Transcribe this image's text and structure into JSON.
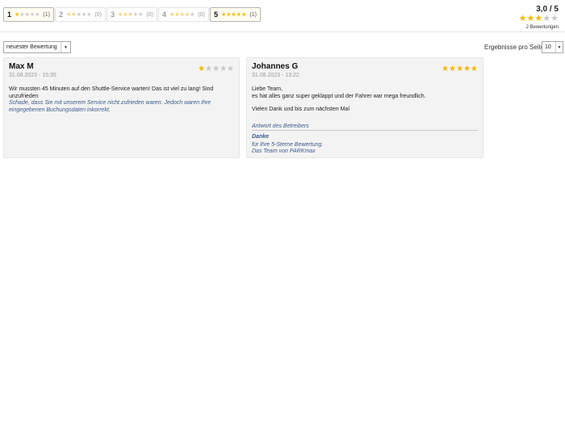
{
  "filters": [
    {
      "num": "1",
      "count": "(1)",
      "filled": 1,
      "active": true
    },
    {
      "num": "2",
      "count": "(0)",
      "filled": 2,
      "active": false
    },
    {
      "num": "3",
      "count": "(0)",
      "filled": 3,
      "active": false
    },
    {
      "num": "4",
      "count": "(0)",
      "filled": 4,
      "active": false
    },
    {
      "num": "5",
      "count": "(1)",
      "filled": 5,
      "active": true
    }
  ],
  "summary": {
    "score": "3,0 / 5",
    "stars_filled": 3,
    "reviews_count": "2 Bewertungen"
  },
  "controls": {
    "sort_value": "neuester Bewertung",
    "per_page_label": "Ergebnisse pro Seite",
    "per_page_value": "10"
  },
  "reviews": [
    {
      "name": "Max M",
      "date": "31.08.2023 - 15:35",
      "rating": 1,
      "text": "Wir mussten 45 Minuten auf den Shuttle-Service warten! Das ist viel zu lang! Sind unzufrieden",
      "reply": "Schade, dass Sie mit unserem Service nicht zufrieden waren. Jedoch waren Ihre eingegebenen Buchungsdaten inkorrekt."
    },
    {
      "name": "Johannes G",
      "date": "31.08.2023 - 13:22",
      "rating": 5,
      "text_lines": [
        "Liebe Team,",
        "es hat alles ganz super geklappt und der Fahrer war mega freundlich."
      ],
      "text2": "Vielen Dank und bis zum nächsten Mal",
      "owner_reply_title": "Antwort des Betreibers",
      "owner_reply_head": "Danke",
      "owner_reply_lines": [
        "für Ihre 5-Sterne Bewertung.",
        "Das Team von PARKmax"
      ]
    }
  ],
  "colors": {
    "star": "#f2b705",
    "star_off": "#c8c8c8",
    "reply": "#3c5a8a",
    "card_bg": "#f3f3f3"
  }
}
